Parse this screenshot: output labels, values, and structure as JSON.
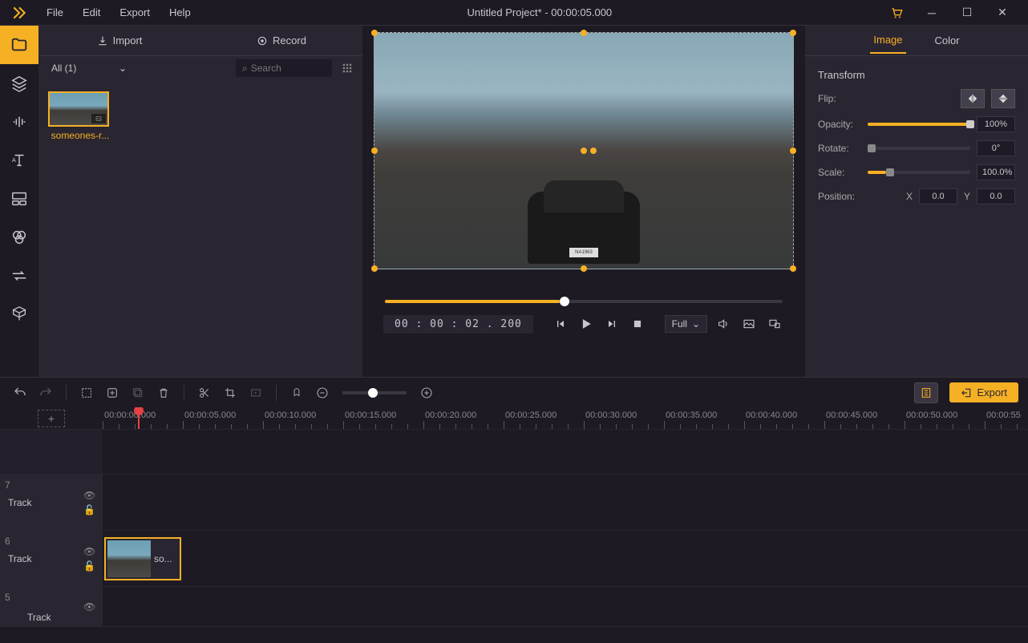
{
  "title": "Untitled Project* - 00:00:05.000",
  "menu": {
    "file": "File",
    "edit": "Edit",
    "export": "Export",
    "help": "Help"
  },
  "library": {
    "tabs": {
      "import": "Import",
      "record": "Record"
    },
    "filter": "All (1)",
    "searchPlaceholder": "Search",
    "clip1": "someones-r..."
  },
  "preview": {
    "timecode": "00 : 00 : 02 . 200",
    "viewMode": "Full",
    "plate": "NA1963"
  },
  "rightPanel": {
    "tabs": {
      "image": "Image",
      "color": "Color"
    },
    "section": "Transform",
    "flipLabel": "Flip:",
    "opacityLabel": "Opacity:",
    "opacityValue": "100%",
    "rotateLabel": "Rotate:",
    "rotateValue": "0°",
    "scaleLabel": "Scale:",
    "scaleValue": "100.0%",
    "positionLabel": "Position:",
    "xLabel": "X",
    "xValue": "0.0",
    "yLabel": "Y",
    "yValue": "0.0"
  },
  "timeline": {
    "exportLabel": "Export",
    "marks": [
      "00:00:00.000",
      "00:00:05.000",
      "00:00:10.000",
      "00:00:15.000",
      "00:00:20.000",
      "00:00:25.000",
      "00:00:30.000",
      "00:00:35.000",
      "00:00:40.000",
      "00:00:45.000",
      "00:00:50.000",
      "00:00:55"
    ],
    "track7": {
      "num": "7",
      "name": "Track"
    },
    "track6": {
      "num": "6",
      "name": "Track",
      "clipLabel": "so..."
    },
    "track5": {
      "num": "5",
      "name": "Track"
    }
  }
}
